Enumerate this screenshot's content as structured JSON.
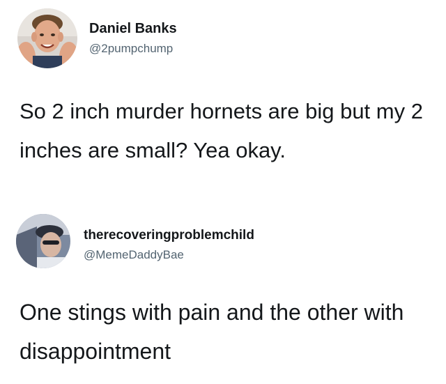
{
  "tweets": [
    {
      "display_name": "Daniel Banks",
      "handle": "@2pumpchump",
      "avatar_icon": "user-avatar-photo",
      "body": "So 2 inch murder hornets are big but my 2 inches are small? Yea okay."
    },
    {
      "display_name": "therecoveringproblemchild",
      "handle": "@MemeDaddyBae",
      "avatar_icon": "user-avatar-photo",
      "body": "One stings with pain and the other with disappointment"
    }
  ],
  "colors": {
    "background": "#ffffff",
    "text_primary": "#14171a",
    "text_secondary": "#536471"
  }
}
